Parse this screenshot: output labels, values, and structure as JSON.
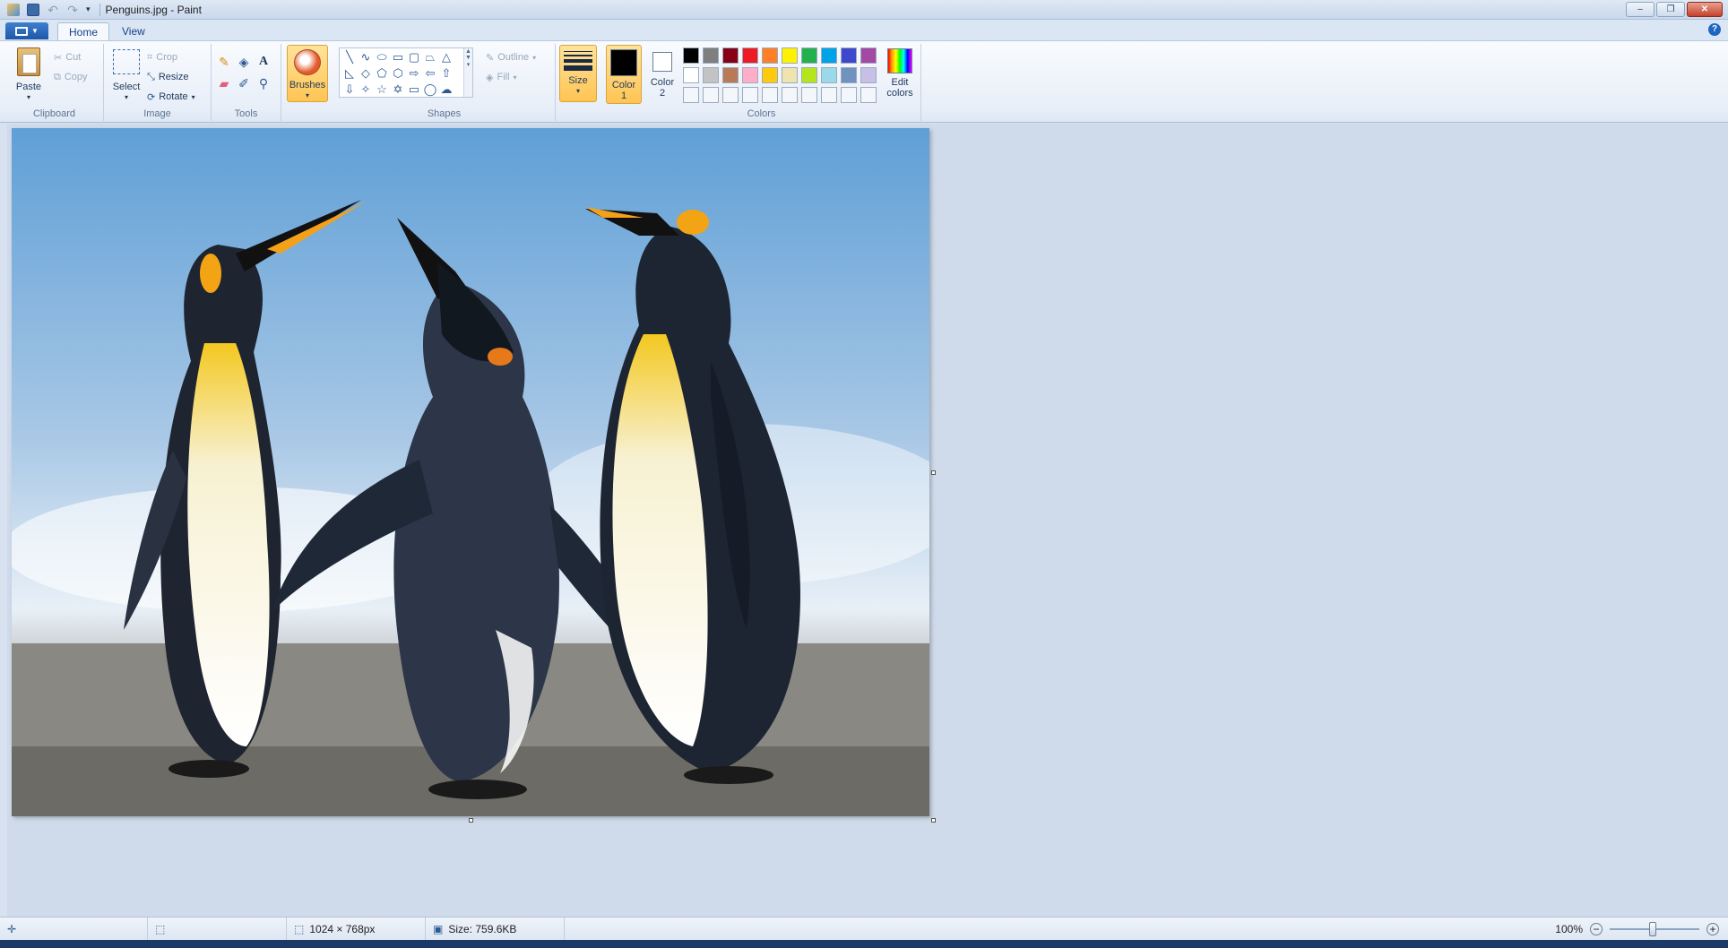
{
  "window": {
    "title": "Penguins.jpg - Paint",
    "controls": {
      "minimize": "–",
      "maximize": "❐",
      "close": "✕"
    }
  },
  "tabs": [
    {
      "label": "Home",
      "active": true
    },
    {
      "label": "View",
      "active": false
    }
  ],
  "ribbon": {
    "clipboard": {
      "label": "Clipboard",
      "paste": "Paste",
      "cut": "Cut",
      "copy": "Copy"
    },
    "image": {
      "label": "Image",
      "select": "Select",
      "crop": "Crop",
      "resize": "Resize",
      "rotate": "Rotate"
    },
    "tools": {
      "label": "Tools"
    },
    "brushes": {
      "label": "Brushes"
    },
    "shapes": {
      "label": "Shapes",
      "outline": "Outline",
      "fill": "Fill"
    },
    "size": {
      "label": "Size"
    },
    "colors": {
      "label": "Colors",
      "color1": "Color\n1",
      "color1_line1": "Color",
      "color1_line2": "1",
      "color2_line1": "Color",
      "color2_line2": "2",
      "edit_line1": "Edit",
      "edit_line2": "colors",
      "color1_value": "#000000",
      "color2_value": "#ffffff",
      "palette_row1": [
        "#000000",
        "#7f7f7f",
        "#880015",
        "#ed1c24",
        "#ff7f27",
        "#fff200",
        "#22b14c",
        "#00a2e8",
        "#3f48cc",
        "#a349a4"
      ],
      "palette_row2": [
        "#ffffff",
        "#c3c3c3",
        "#b97a57",
        "#ffaec9",
        "#ffc90e",
        "#efe4b0",
        "#b5e61d",
        "#99d9ea",
        "#7092be",
        "#c8bfe7"
      ],
      "palette_row3": [
        "#f3f6fa",
        "#f3f6fa",
        "#f3f6fa",
        "#f3f6fa",
        "#f3f6fa",
        "#f3f6fa",
        "#f3f6fa",
        "#f3f6fa",
        "#f3f6fa",
        "#f3f6fa"
      ]
    }
  },
  "status": {
    "dimensions": "1024 × 768px",
    "size": "Size: 759.6KB",
    "zoom": "100%"
  }
}
